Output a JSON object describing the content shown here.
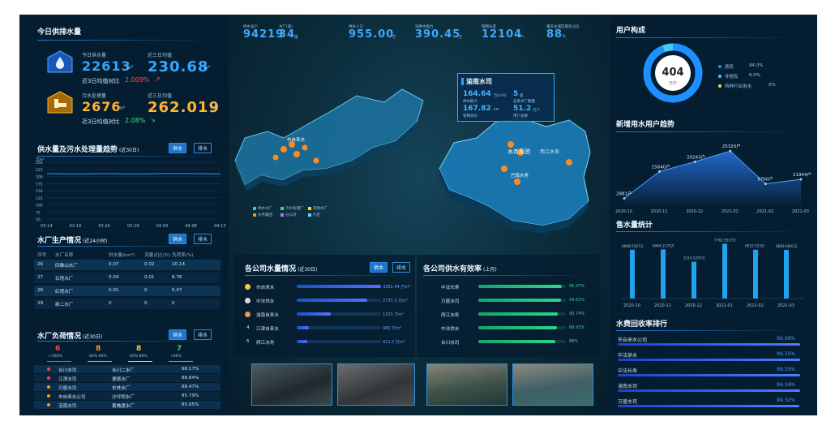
{
  "supply": {
    "title": "今日供排水量",
    "today_supply_label": "今日供水量",
    "today_supply_value": "22613",
    "today_supply_unit": "m³",
    "three_day_avg_label": "近三日均值",
    "three_day_avg_value": "230.68",
    "three_day_avg_unit": "m³",
    "compare_label": "近3日均值对比",
    "compare_value": "2.009%",
    "sewage_label": "污水处理量",
    "sewage_value": "2676",
    "sewage_unit": "m³",
    "sewage_avg_label": "近三日均值",
    "sewage_avg_value": "262.019",
    "sewage_avg_unit": "m³",
    "sewage_compare_label": "近3日均值对比",
    "sewage_compare_value": "2.08%"
  },
  "trend": {
    "title": "供水量及污水处理量趋势",
    "sub": "(近30日)",
    "btn_supply": "供水",
    "btn_drain": "排水",
    "yunit": "万m³",
    "y_ticks": [
      "250",
      "225",
      "200",
      "175",
      "150",
      "125",
      "100",
      "75",
      "50"
    ]
  },
  "plant": {
    "title": "水厂生产情况",
    "sub": "(近24小时)",
    "btn_supply": "供水",
    "btn_drain": "排水",
    "headers": [
      "序号",
      "水厂名称",
      "供水量(km³)",
      "流量占比(%)",
      "负荷率(%)"
    ],
    "rows": [
      [
        "26",
        "四雅山水厂",
        "0.07",
        "0.02",
        "10.14"
      ],
      [
        "27",
        "石塔水厂",
        "0.04",
        "0.01",
        "8.76"
      ],
      [
        "28",
        "红塔水厂",
        "0.01",
        "0",
        "5.47"
      ],
      [
        "29",
        "新二水厂",
        "0",
        "0",
        "0"
      ]
    ]
  },
  "load": {
    "title": "水厂负荷情况",
    "sub": "(近30日)",
    "btn_supply": "供水",
    "btn_drain": "排水",
    "stats": [
      {
        "v": "6",
        "l": ">100%",
        "c": "#ff4545"
      },
      {
        "v": "8",
        "l": "80%-90%",
        "c": "#ff9a1a"
      },
      {
        "v": "8",
        "l": "60%-80%",
        "c": "#e8d838"
      },
      {
        "v": "7",
        "l": "<60%",
        "c": "#35d07a"
      }
    ],
    "rows": [
      [
        "合川水司",
        "合川二水厂",
        "98.17%",
        "#ff4545"
      ],
      [
        "江津水司",
        "德感水厂",
        "88.84%",
        "#ff4545"
      ],
      [
        "万盛水司",
        "东林水厂",
        "88.47%",
        "#ff9a1a"
      ],
      [
        "市自来水公司",
        "沙坪坝水厂",
        "85.79%",
        "#ff9a1a"
      ],
      [
        "涪南水司",
        "黄桷渡水厂",
        "85.65%",
        "#ff9a1a"
      ]
    ]
  },
  "top": {
    "items": [
      {
        "label": "供水总户",
        "value": "94219",
        "unit": "户"
      },
      {
        "label": "水厂(座)",
        "value": "34",
        "unit": "座"
      },
      {
        "label": "供水人口",
        "value": "955.00",
        "unit": "万"
      },
      {
        "label": "日供水能力",
        "value": "390.45",
        "unit": "万"
      },
      {
        "label": "管网长度",
        "value": "12104",
        "unit": "km"
      },
      {
        "label": "重庆主城区服务占比",
        "value": "88",
        "unit": "%"
      }
    ]
  },
  "map": {
    "popup": {
      "title": "渝南水司",
      "v1": "164.64",
      "u1": "万m³/d",
      "l1": "供水能力",
      "v2": "5",
      "u2": "座",
      "l2": "自来水厂数量",
      "v3": "167.82",
      "u3": "km",
      "l3": "管网总长",
      "v4": "51.2",
      "u4": "万户",
      "l4": "用户总数"
    },
    "labels": [
      "水务集团",
      "两江水务",
      "市自来水",
      "巴南水务"
    ],
    "legend": [
      "供水水厂",
      "污水处理厂",
      "其他水厂",
      "水务集团",
      "分公司",
      "片区"
    ]
  },
  "company": {
    "title": "各公司水量情况",
    "sub": "(近30日)",
    "btn_supply": "供水",
    "btn_drain": "排水",
    "rows": [
      {
        "rank": "1",
        "name": "市自来水",
        "value": "3262.44 万m³"
      },
      {
        "rank": "2",
        "name": "中法供水",
        "value": "2737.3 万m³"
      },
      {
        "rank": "3",
        "name": "渝南自来水",
        "value": "1323 万m³"
      },
      {
        "rank": "4",
        "name": "江津自来水",
        "value": "480 万m³"
      },
      {
        "rank": "5",
        "name": "两江水务",
        "value": "411.2 万m³"
      }
    ]
  },
  "efficiency": {
    "title": "各公司供水有效率",
    "sub": "(上月)",
    "rows": [
      {
        "name": "中法长寿",
        "value": "95.47%"
      },
      {
        "name": "万盛水司",
        "value": "94.63%"
      },
      {
        "name": "两江水务",
        "value": "90.74%"
      },
      {
        "name": "中法供水",
        "value": "89.93%"
      },
      {
        "name": "合川水司",
        "value": "88%"
      }
    ]
  },
  "users": {
    "title": "用户构成",
    "total": "404",
    "unit": "万户",
    "legend": [
      {
        "name": "居民",
        "pct": "94.0%",
        "color": "#1e8fff"
      },
      {
        "name": "非居民",
        "pct": "6.0%",
        "color": "#49c6f2"
      },
      {
        "name": "特种行业用水",
        "pct": "0%",
        "color": "#f5d83a"
      }
    ]
  },
  "newusers": {
    "title": "新增用水用户趋势",
    "unit": "户",
    "labels": [
      "2881户",
      "15640户",
      "20243户",
      "25320户",
      "9760户",
      "11944户"
    ]
  },
  "sales": {
    "title": "售水量统计",
    "labels": [
      "6908.5567万",
      "6964.2175万",
      "5214.5297万",
      "7762.5527万",
      "6922.523万",
      "6883.6602万"
    ]
  },
  "fee": {
    "title": "水费回收率排行",
    "rows": [
      {
        "name": "市自来水公司",
        "value": "99.36%"
      },
      {
        "name": "中法供水",
        "value": "99.35%"
      },
      {
        "name": "中法长寿",
        "value": "99.35%"
      },
      {
        "name": "渝南水司",
        "value": "99.34%"
      },
      {
        "name": "万盛水司",
        "value": "99.32%"
      }
    ]
  },
  "chart_data": [
    {
      "type": "line",
      "title": "供水量及污水处理量趋势",
      "ylabel": "万m³",
      "ylim": [
        50,
        250
      ],
      "x": [
        "03-14",
        "03-19",
        "03-24",
        "03-29",
        "04-03",
        "04-08",
        "04-13"
      ],
      "series": [
        {
          "values": [
            210,
            209,
            210,
            209,
            210,
            210,
            209
          ]
        }
      ]
    },
    {
      "type": "area",
      "title": "新增用水用户趋势",
      "x": [
        "2020-10",
        "2020-11",
        "2020-12",
        "2021-01",
        "2021-02",
        "2021-03"
      ],
      "series": [
        {
          "values": [
            2881,
            15640,
            20243,
            25320,
            9760,
            11944
          ]
        }
      ]
    },
    {
      "type": "bar",
      "title": "售水量统计",
      "categories": [
        "2020-10",
        "2020-11",
        "2020-12",
        "2021-01",
        "2021-02",
        "2021-03"
      ],
      "values": [
        6908.5567,
        6964.2175,
        5214.5297,
        7762.5527,
        6922.523,
        6883.6602
      ]
    },
    {
      "type": "pie",
      "title": "用户构成",
      "categories": [
        "居民",
        "非居民",
        "特种行业用水"
      ],
      "values": [
        94.0,
        6.0,
        0
      ]
    }
  ]
}
